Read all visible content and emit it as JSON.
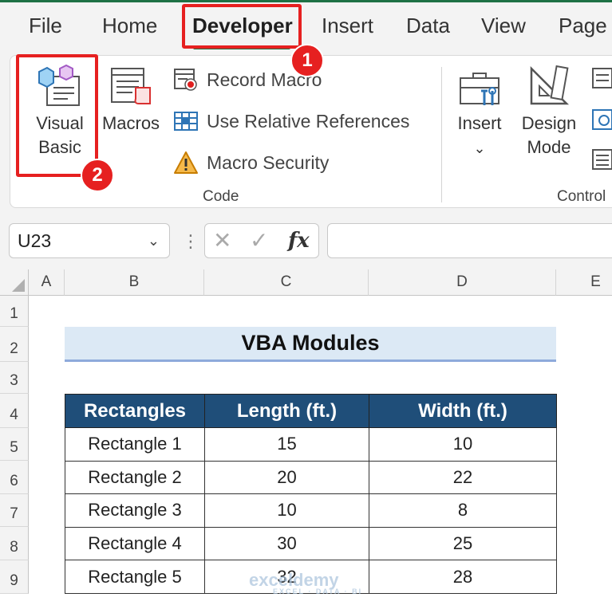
{
  "menu": {
    "tabs": [
      {
        "label": "File"
      },
      {
        "label": "Home"
      },
      {
        "label": "Developer"
      },
      {
        "label": "Insert"
      },
      {
        "label": "Data"
      },
      {
        "label": "View"
      },
      {
        "label": "Page"
      }
    ]
  },
  "ribbon": {
    "code_group": {
      "visual_basic_line1": "Visual",
      "visual_basic_line2": "Basic",
      "macros": "Macros",
      "record_macro": "Record Macro",
      "use_relative": "Use Relative References",
      "macro_security": "Macro Security",
      "group_label": "Code"
    },
    "controls_group": {
      "insert": "Insert",
      "insert_chevron": "⌄",
      "design_line1": "Design",
      "design_line2": "Mode",
      "group_label": "Control"
    }
  },
  "callouts": {
    "step1": "1",
    "step2": "2"
  },
  "formula_bar": {
    "name_box": "U23",
    "fx": "fx",
    "cancel": "✕",
    "enter": "✓"
  },
  "sheet": {
    "columns": [
      "A",
      "B",
      "C",
      "D",
      "E"
    ],
    "rows": [
      "1",
      "2",
      "3",
      "4",
      "5",
      "6",
      "7",
      "8",
      "9"
    ],
    "title": "VBA Modules",
    "table": {
      "headers": [
        "Rectangles",
        "Length (ft.)",
        "Width (ft.)"
      ],
      "rows": [
        [
          "Rectangle 1",
          "15",
          "10"
        ],
        [
          "Rectangle 2",
          "20",
          "22"
        ],
        [
          "Rectangle 3",
          "10",
          "8"
        ],
        [
          "Rectangle 4",
          "30",
          "25"
        ],
        [
          "Rectangle 5",
          "32",
          "28"
        ]
      ]
    }
  },
  "watermark": {
    "main": "exceldemy",
    "sub": "EXCEL · DATA · BI"
  }
}
